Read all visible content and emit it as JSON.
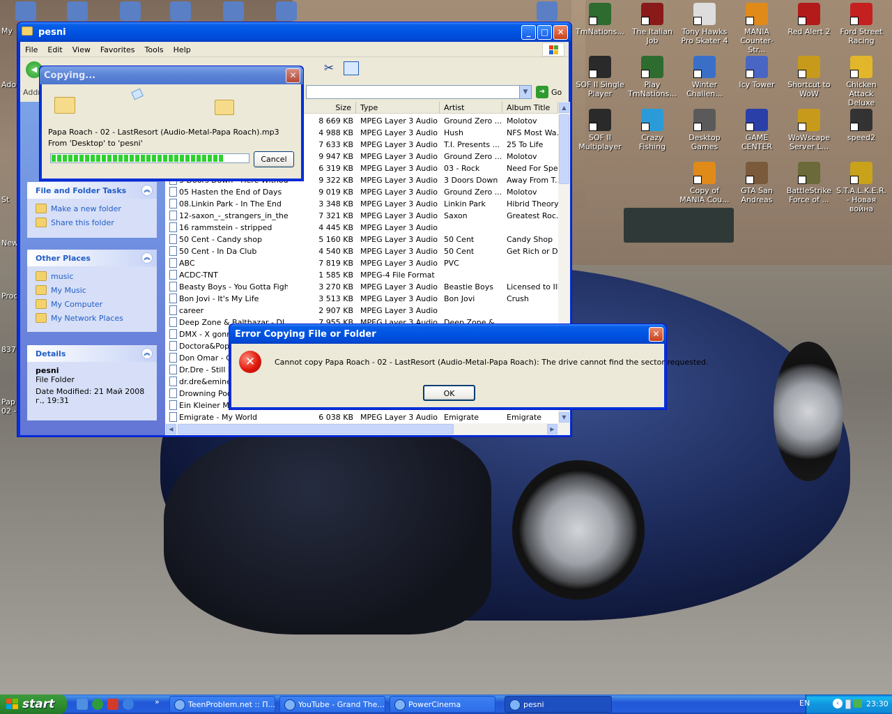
{
  "desktop": {
    "icons": [
      {
        "label": "TmNations...",
        "color": "#2e6b2e"
      },
      {
        "label": "The Italian Job",
        "color": "#8a1a1a"
      },
      {
        "label": "Tony Hawks Pro Skater 4",
        "color": "#dddddd"
      },
      {
        "label": "MANIA Counter-Str...",
        "color": "#e08a1a"
      },
      {
        "label": "Red Alert 2",
        "color": "#b31b1b"
      },
      {
        "label": "Ford Street Racing",
        "color": "#c42020"
      },
      {
        "label": "SOF II Single Player",
        "color": "#2a2a2a"
      },
      {
        "label": "Play TmNations...",
        "color": "#2e6b2e"
      },
      {
        "label": "Winter Challen...",
        "color": "#3a6fc8"
      },
      {
        "label": "Icy Tower",
        "color": "#4a66c4"
      },
      {
        "label": "Shortcut to WoW",
        "color": "#c79a1c"
      },
      {
        "label": "Chicken Attack Deluxe",
        "color": "#e2b62a"
      },
      {
        "label": "SOF II Multiplayer",
        "color": "#2a2a2a"
      },
      {
        "label": "Crazy Fishing",
        "color": "#2a9bd8"
      },
      {
        "label": "Desktop Games",
        "color": "#5a5a5a"
      },
      {
        "label": "GAME CENTER",
        "color": "#2a3fa8"
      },
      {
        "label": "WoWscape Server L...",
        "color": "#c79a1c"
      },
      {
        "label": "speed2",
        "color": "#333333"
      },
      {
        "label": "Copy of MANIA Cou...",
        "color": "#e08a1a"
      },
      {
        "label": "GTA San Andreas",
        "color": "#7a5a3a"
      },
      {
        "label": "BattleStrike Force of ...",
        "color": "#6b6a3a"
      },
      {
        "label": "S.T.A.L.K.E.R. - Новая война",
        "color": "#c9a21c"
      }
    ],
    "left_edge_labels": [
      "My",
      "Ado",
      "St",
      "New",
      "Proc",
      "837",
      "Pap 02 -"
    ]
  },
  "explorer": {
    "title": "pesni",
    "menu": [
      "File",
      "Edit",
      "View",
      "Favorites",
      "Tools",
      "Help"
    ],
    "address_label": "Addr",
    "go_label": "Go",
    "tasks_panel": {
      "title": "File and Folder Tasks",
      "links": [
        "Make a new folder",
        "Share this folder"
      ]
    },
    "places_panel": {
      "title": "Other Places",
      "links": [
        "music",
        "My Music",
        "My Computer",
        "My Network Places"
      ]
    },
    "details_panel": {
      "title": "Details",
      "name": "pesni",
      "type": "File Folder",
      "modified": "Date Modified: 21 Май 2008 г., 19:31"
    },
    "columns": {
      "size": "Size",
      "type": "Type",
      "artist": "Artist",
      "album": "Album Title"
    },
    "files": [
      {
        "name": "",
        "size": "8 669 KB",
        "type": "MPEG Layer 3 Audio...",
        "artist": "Ground Zero ...",
        "album": "Molotov"
      },
      {
        "name": "",
        "size": "4 988 KB",
        "type": "MPEG Layer 3 Audio...",
        "artist": "Hush",
        "album": "NFS Most Wa..."
      },
      {
        "name": "",
        "size": "7 633 KB",
        "type": "MPEG Layer 3 Audio...",
        "artist": "T.I. Presents ...",
        "album": "25 To Life"
      },
      {
        "name": "",
        "size": "9 947 KB",
        "type": "MPEG Layer 3 Audio...",
        "artist": "Ground Zero ...",
        "album": "Molotov"
      },
      {
        "name": "",
        "size": "6 319 KB",
        "type": "MPEG Layer 3 Audio...",
        "artist": "03 - Rock",
        "album": "Need For Spe..."
      },
      {
        "name": "3 Doors Down - Here Without ...",
        "size": "9 322 KB",
        "type": "MPEG Layer 3 Audio...",
        "artist": "3 Doors Down",
        "album": "Away From T..."
      },
      {
        "name": "05 Hasten the End of Days",
        "size": "9 019 KB",
        "type": "MPEG Layer 3 Audio...",
        "artist": "Ground Zero ...",
        "album": "Molotov"
      },
      {
        "name": "08.Linkin Park - In The End",
        "size": "3 348 KB",
        "type": "MPEG Layer 3 Audio...",
        "artist": "Linkin Park",
        "album": "Hibrid Theory"
      },
      {
        "name": "12-saxon_-_strangers_in_the...",
        "size": "7 321 KB",
        "type": "MPEG Layer 3 Audio...",
        "artist": "Saxon",
        "album": "Greatest Roc..."
      },
      {
        "name": "16 rammstein - stripped",
        "size": "4 445 KB",
        "type": "MPEG Layer 3 Audio...",
        "artist": "",
        "album": ""
      },
      {
        "name": "50 Cent - Candy shop",
        "size": "5 160 KB",
        "type": "MPEG Layer 3 Audio...",
        "artist": "50 Cent",
        "album": "Candy Shop"
      },
      {
        "name": "50 Cent - In Da Club",
        "size": "4 540 KB",
        "type": "MPEG Layer 3 Audio...",
        "artist": "50 Cent",
        "album": "Get Rich or Di..."
      },
      {
        "name": "ABC",
        "size": "7 819 KB",
        "type": "MPEG Layer 3 Audio...",
        "artist": "PVC",
        "album": ""
      },
      {
        "name": "ACDC-TNT",
        "size": "1 585 KB",
        "type": "MPEG-4 File Format",
        "artist": "",
        "album": ""
      },
      {
        "name": "Beasty Boys - You Gotta Fight",
        "size": "3 270 KB",
        "type": "MPEG Layer 3 Audio...",
        "artist": "Beastie Boys",
        "album": "Licensed to Ill"
      },
      {
        "name": "Bon Jovi - It's My Life",
        "size": "3 513 KB",
        "type": "MPEG Layer 3 Audio...",
        "artist": "Bon Jovi",
        "album": "Crush"
      },
      {
        "name": "career",
        "size": "2 907 KB",
        "type": "MPEG Layer 3 Audio...",
        "artist": "",
        "album": ""
      },
      {
        "name": "Deep Zone & Balthazar - DJ",
        "size": "7 955 KB",
        "type": "MPEG Layer 3 Audio...",
        "artist": "Deep Zone &...",
        "album": ""
      },
      {
        "name": "DMX - X gonna",
        "size": "",
        "type": "",
        "artist": "",
        "album": ""
      },
      {
        "name": "Doctora&Popa",
        "size": "",
        "type": "",
        "artist": "",
        "album": ""
      },
      {
        "name": "Don Omar - Gu",
        "size": "",
        "type": "",
        "artist": "",
        "album": ""
      },
      {
        "name": "Dr.Dre - Still D",
        "size": "",
        "type": "",
        "artist": "",
        "album": ""
      },
      {
        "name": "dr.dre&eminem",
        "size": "",
        "type": "",
        "artist": "",
        "album": ""
      },
      {
        "name": "Drowning Pool",
        "size": "",
        "type": "",
        "artist": "",
        "album": ""
      },
      {
        "name": "Ein Kleiner Men",
        "size": "",
        "type": "",
        "artist": "",
        "album": ""
      },
      {
        "name": "Emigrate - My World",
        "size": "6 038 KB",
        "type": "MPEG Layer 3 Audio...",
        "artist": "Emigrate",
        "album": "Emigrate"
      }
    ]
  },
  "copy_dialog": {
    "title": "Copying...",
    "filename": "Papa Roach - 02 -  LastResort (Audio-Metal-Papa Roach).mp3",
    "from_to": "From 'Desktop' to 'pesni'",
    "progress": 0.88,
    "cancel_label": "Cancel"
  },
  "error_dialog": {
    "title": "Error Copying File or Folder",
    "message": "Cannot copy Papa Roach - 02 -  LastResort (Audio-Metal-Papa Roach): The drive cannot find the sector requested.",
    "ok_label": "OK"
  },
  "taskbar": {
    "start_label": "start",
    "tasks": [
      {
        "label": "TeenProblem.net :: П...",
        "active": false
      },
      {
        "label": "YouTube - Grand The...",
        "active": false
      },
      {
        "label": "PowerCinema",
        "active": false
      },
      {
        "label": "pesni",
        "active": true
      }
    ],
    "language": "EN",
    "clock": "23:30"
  }
}
